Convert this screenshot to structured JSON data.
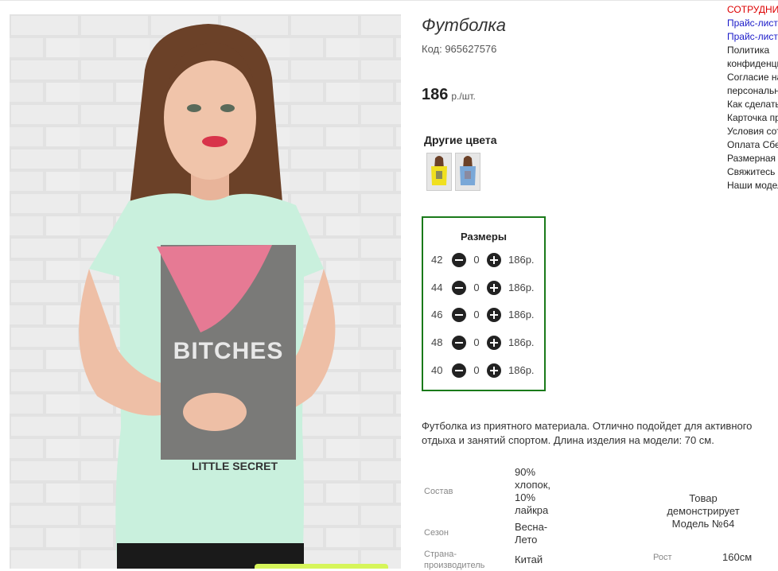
{
  "product": {
    "title": "Футболка",
    "code": "Код: 965627576",
    "price": "186",
    "price_unit": "р./шт."
  },
  "colors": {
    "heading": "Другие цвета",
    "swatches": [
      {
        "name": "yellow",
        "color": "#f0e020"
      },
      {
        "name": "blue",
        "color": "#7aa8d8"
      }
    ]
  },
  "sizes": {
    "heading": "Размеры",
    "rows": [
      {
        "size": "42",
        "qty": "0",
        "price": "186р."
      },
      {
        "size": "44",
        "qty": "0",
        "price": "186р."
      },
      {
        "size": "46",
        "qty": "0",
        "price": "186р."
      },
      {
        "size": "48",
        "qty": "0",
        "price": "186р."
      },
      {
        "size": "40",
        "qty": "0",
        "price": "186р."
      }
    ]
  },
  "description": {
    "line1": "Футболка из приятного материала. Отлично подойдет для активного",
    "line2": "отдыха и занятий спортом. Длина изделия на модели: 70 см."
  },
  "specs": {
    "composition_label": "Состав",
    "composition_value": [
      "90%",
      "хлопок,",
      "10%",
      "лайкра"
    ],
    "season_label": "Сезон",
    "season_value": [
      "Весна-",
      "Лето"
    ],
    "country_label": [
      "Страна-",
      "производитель"
    ],
    "country_value": "Китай",
    "height_label": "Рост",
    "height_value": "160см",
    "model_note": [
      "Товар",
      "демонстрирует",
      "Модель №64"
    ]
  },
  "menu": {
    "items": [
      {
        "label": "СОТРУДНИЧЕСТВО",
        "style": "red"
      },
      {
        "label": "Прайс-лист",
        "style": "blue"
      },
      {
        "label": "Прайс-лист",
        "style": "blue"
      },
      {
        "label": "Политика",
        "style": "dark"
      },
      {
        "label": "конфиденциальности",
        "style": "dark"
      },
      {
        "label": "Согласие на обработку",
        "style": "dark"
      },
      {
        "label": "персональных данных",
        "style": "dark"
      },
      {
        "label": "Как сделать заказ",
        "style": "dark"
      },
      {
        "label": "Карточка предприятия",
        "style": "dark"
      },
      {
        "label": "Условия сотрудничества",
        "style": "dark"
      },
      {
        "label": "Оплата Сбербанк",
        "style": "dark"
      },
      {
        "label": "Размерная сетка",
        "style": "dark"
      },
      {
        "label": "Свяжитесь с нами",
        "style": "dark"
      },
      {
        "label": "Наши модели",
        "style": "dark"
      }
    ]
  },
  "tshirt_print": {
    "top_text": "BITCHES",
    "bottom_text": "LITTLE SECRET"
  },
  "colors_theme": {
    "accent_green": "#1a7a1a",
    "menu_red": "#d00000",
    "menu_blue": "#1a1ac8"
  }
}
